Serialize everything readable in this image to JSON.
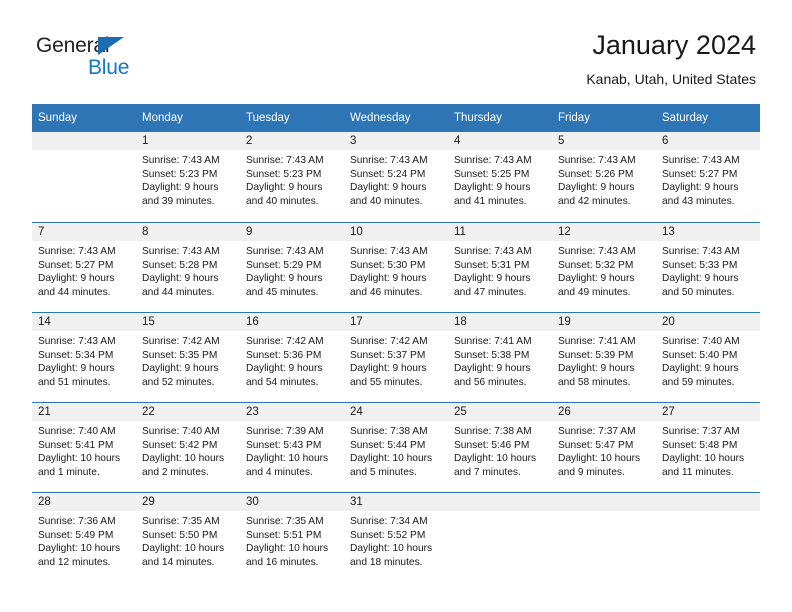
{
  "brand": {
    "line1": "General",
    "line2": "Blue",
    "accent_color": "#1479c4",
    "triangle_color": "#1b6cb0"
  },
  "header": {
    "title": "January 2024",
    "subtitle": "Kanab, Utah, United States"
  },
  "theme": {
    "header_row_bg": "#2e75b6",
    "daynum_bg": "#f0f0f0",
    "text_color": "#1a1a1a"
  },
  "weekdays": [
    "Sunday",
    "Monday",
    "Tuesday",
    "Wednesday",
    "Thursday",
    "Friday",
    "Saturday"
  ],
  "weeks": [
    [
      {
        "day": "",
        "sunrise": "",
        "sunset": "",
        "daylight1": "",
        "daylight2": ""
      },
      {
        "day": "1",
        "sunrise": "Sunrise: 7:43 AM",
        "sunset": "Sunset: 5:23 PM",
        "daylight1": "Daylight: 9 hours",
        "daylight2": "and 39 minutes."
      },
      {
        "day": "2",
        "sunrise": "Sunrise: 7:43 AM",
        "sunset": "Sunset: 5:23 PM",
        "daylight1": "Daylight: 9 hours",
        "daylight2": "and 40 minutes."
      },
      {
        "day": "3",
        "sunrise": "Sunrise: 7:43 AM",
        "sunset": "Sunset: 5:24 PM",
        "daylight1": "Daylight: 9 hours",
        "daylight2": "and 40 minutes."
      },
      {
        "day": "4",
        "sunrise": "Sunrise: 7:43 AM",
        "sunset": "Sunset: 5:25 PM",
        "daylight1": "Daylight: 9 hours",
        "daylight2": "and 41 minutes."
      },
      {
        "day": "5",
        "sunrise": "Sunrise: 7:43 AM",
        "sunset": "Sunset: 5:26 PM",
        "daylight1": "Daylight: 9 hours",
        "daylight2": "and 42 minutes."
      },
      {
        "day": "6",
        "sunrise": "Sunrise: 7:43 AM",
        "sunset": "Sunset: 5:27 PM",
        "daylight1": "Daylight: 9 hours",
        "daylight2": "and 43 minutes."
      }
    ],
    [
      {
        "day": "7",
        "sunrise": "Sunrise: 7:43 AM",
        "sunset": "Sunset: 5:27 PM",
        "daylight1": "Daylight: 9 hours",
        "daylight2": "and 44 minutes."
      },
      {
        "day": "8",
        "sunrise": "Sunrise: 7:43 AM",
        "sunset": "Sunset: 5:28 PM",
        "daylight1": "Daylight: 9 hours",
        "daylight2": "and 44 minutes."
      },
      {
        "day": "9",
        "sunrise": "Sunrise: 7:43 AM",
        "sunset": "Sunset: 5:29 PM",
        "daylight1": "Daylight: 9 hours",
        "daylight2": "and 45 minutes."
      },
      {
        "day": "10",
        "sunrise": "Sunrise: 7:43 AM",
        "sunset": "Sunset: 5:30 PM",
        "daylight1": "Daylight: 9 hours",
        "daylight2": "and 46 minutes."
      },
      {
        "day": "11",
        "sunrise": "Sunrise: 7:43 AM",
        "sunset": "Sunset: 5:31 PM",
        "daylight1": "Daylight: 9 hours",
        "daylight2": "and 47 minutes."
      },
      {
        "day": "12",
        "sunrise": "Sunrise: 7:43 AM",
        "sunset": "Sunset: 5:32 PM",
        "daylight1": "Daylight: 9 hours",
        "daylight2": "and 49 minutes."
      },
      {
        "day": "13",
        "sunrise": "Sunrise: 7:43 AM",
        "sunset": "Sunset: 5:33 PM",
        "daylight1": "Daylight: 9 hours",
        "daylight2": "and 50 minutes."
      }
    ],
    [
      {
        "day": "14",
        "sunrise": "Sunrise: 7:43 AM",
        "sunset": "Sunset: 5:34 PM",
        "daylight1": "Daylight: 9 hours",
        "daylight2": "and 51 minutes."
      },
      {
        "day": "15",
        "sunrise": "Sunrise: 7:42 AM",
        "sunset": "Sunset: 5:35 PM",
        "daylight1": "Daylight: 9 hours",
        "daylight2": "and 52 minutes."
      },
      {
        "day": "16",
        "sunrise": "Sunrise: 7:42 AM",
        "sunset": "Sunset: 5:36 PM",
        "daylight1": "Daylight: 9 hours",
        "daylight2": "and 54 minutes."
      },
      {
        "day": "17",
        "sunrise": "Sunrise: 7:42 AM",
        "sunset": "Sunset: 5:37 PM",
        "daylight1": "Daylight: 9 hours",
        "daylight2": "and 55 minutes."
      },
      {
        "day": "18",
        "sunrise": "Sunrise: 7:41 AM",
        "sunset": "Sunset: 5:38 PM",
        "daylight1": "Daylight: 9 hours",
        "daylight2": "and 56 minutes."
      },
      {
        "day": "19",
        "sunrise": "Sunrise: 7:41 AM",
        "sunset": "Sunset: 5:39 PM",
        "daylight1": "Daylight: 9 hours",
        "daylight2": "and 58 minutes."
      },
      {
        "day": "20",
        "sunrise": "Sunrise: 7:40 AM",
        "sunset": "Sunset: 5:40 PM",
        "daylight1": "Daylight: 9 hours",
        "daylight2": "and 59 minutes."
      }
    ],
    [
      {
        "day": "21",
        "sunrise": "Sunrise: 7:40 AM",
        "sunset": "Sunset: 5:41 PM",
        "daylight1": "Daylight: 10 hours",
        "daylight2": "and 1 minute."
      },
      {
        "day": "22",
        "sunrise": "Sunrise: 7:40 AM",
        "sunset": "Sunset: 5:42 PM",
        "daylight1": "Daylight: 10 hours",
        "daylight2": "and 2 minutes."
      },
      {
        "day": "23",
        "sunrise": "Sunrise: 7:39 AM",
        "sunset": "Sunset: 5:43 PM",
        "daylight1": "Daylight: 10 hours",
        "daylight2": "and 4 minutes."
      },
      {
        "day": "24",
        "sunrise": "Sunrise: 7:38 AM",
        "sunset": "Sunset: 5:44 PM",
        "daylight1": "Daylight: 10 hours",
        "daylight2": "and 5 minutes."
      },
      {
        "day": "25",
        "sunrise": "Sunrise: 7:38 AM",
        "sunset": "Sunset: 5:46 PM",
        "daylight1": "Daylight: 10 hours",
        "daylight2": "and 7 minutes."
      },
      {
        "day": "26",
        "sunrise": "Sunrise: 7:37 AM",
        "sunset": "Sunset: 5:47 PM",
        "daylight1": "Daylight: 10 hours",
        "daylight2": "and 9 minutes."
      },
      {
        "day": "27",
        "sunrise": "Sunrise: 7:37 AM",
        "sunset": "Sunset: 5:48 PM",
        "daylight1": "Daylight: 10 hours",
        "daylight2": "and 11 minutes."
      }
    ],
    [
      {
        "day": "28",
        "sunrise": "Sunrise: 7:36 AM",
        "sunset": "Sunset: 5:49 PM",
        "daylight1": "Daylight: 10 hours",
        "daylight2": "and 12 minutes."
      },
      {
        "day": "29",
        "sunrise": "Sunrise: 7:35 AM",
        "sunset": "Sunset: 5:50 PM",
        "daylight1": "Daylight: 10 hours",
        "daylight2": "and 14 minutes."
      },
      {
        "day": "30",
        "sunrise": "Sunrise: 7:35 AM",
        "sunset": "Sunset: 5:51 PM",
        "daylight1": "Daylight: 10 hours",
        "daylight2": "and 16 minutes."
      },
      {
        "day": "31",
        "sunrise": "Sunrise: 7:34 AM",
        "sunset": "Sunset: 5:52 PM",
        "daylight1": "Daylight: 10 hours",
        "daylight2": "and 18 minutes."
      },
      {
        "day": "",
        "sunrise": "",
        "sunset": "",
        "daylight1": "",
        "daylight2": ""
      },
      {
        "day": "",
        "sunrise": "",
        "sunset": "",
        "daylight1": "",
        "daylight2": ""
      },
      {
        "day": "",
        "sunrise": "",
        "sunset": "",
        "daylight1": "",
        "daylight2": ""
      }
    ]
  ]
}
